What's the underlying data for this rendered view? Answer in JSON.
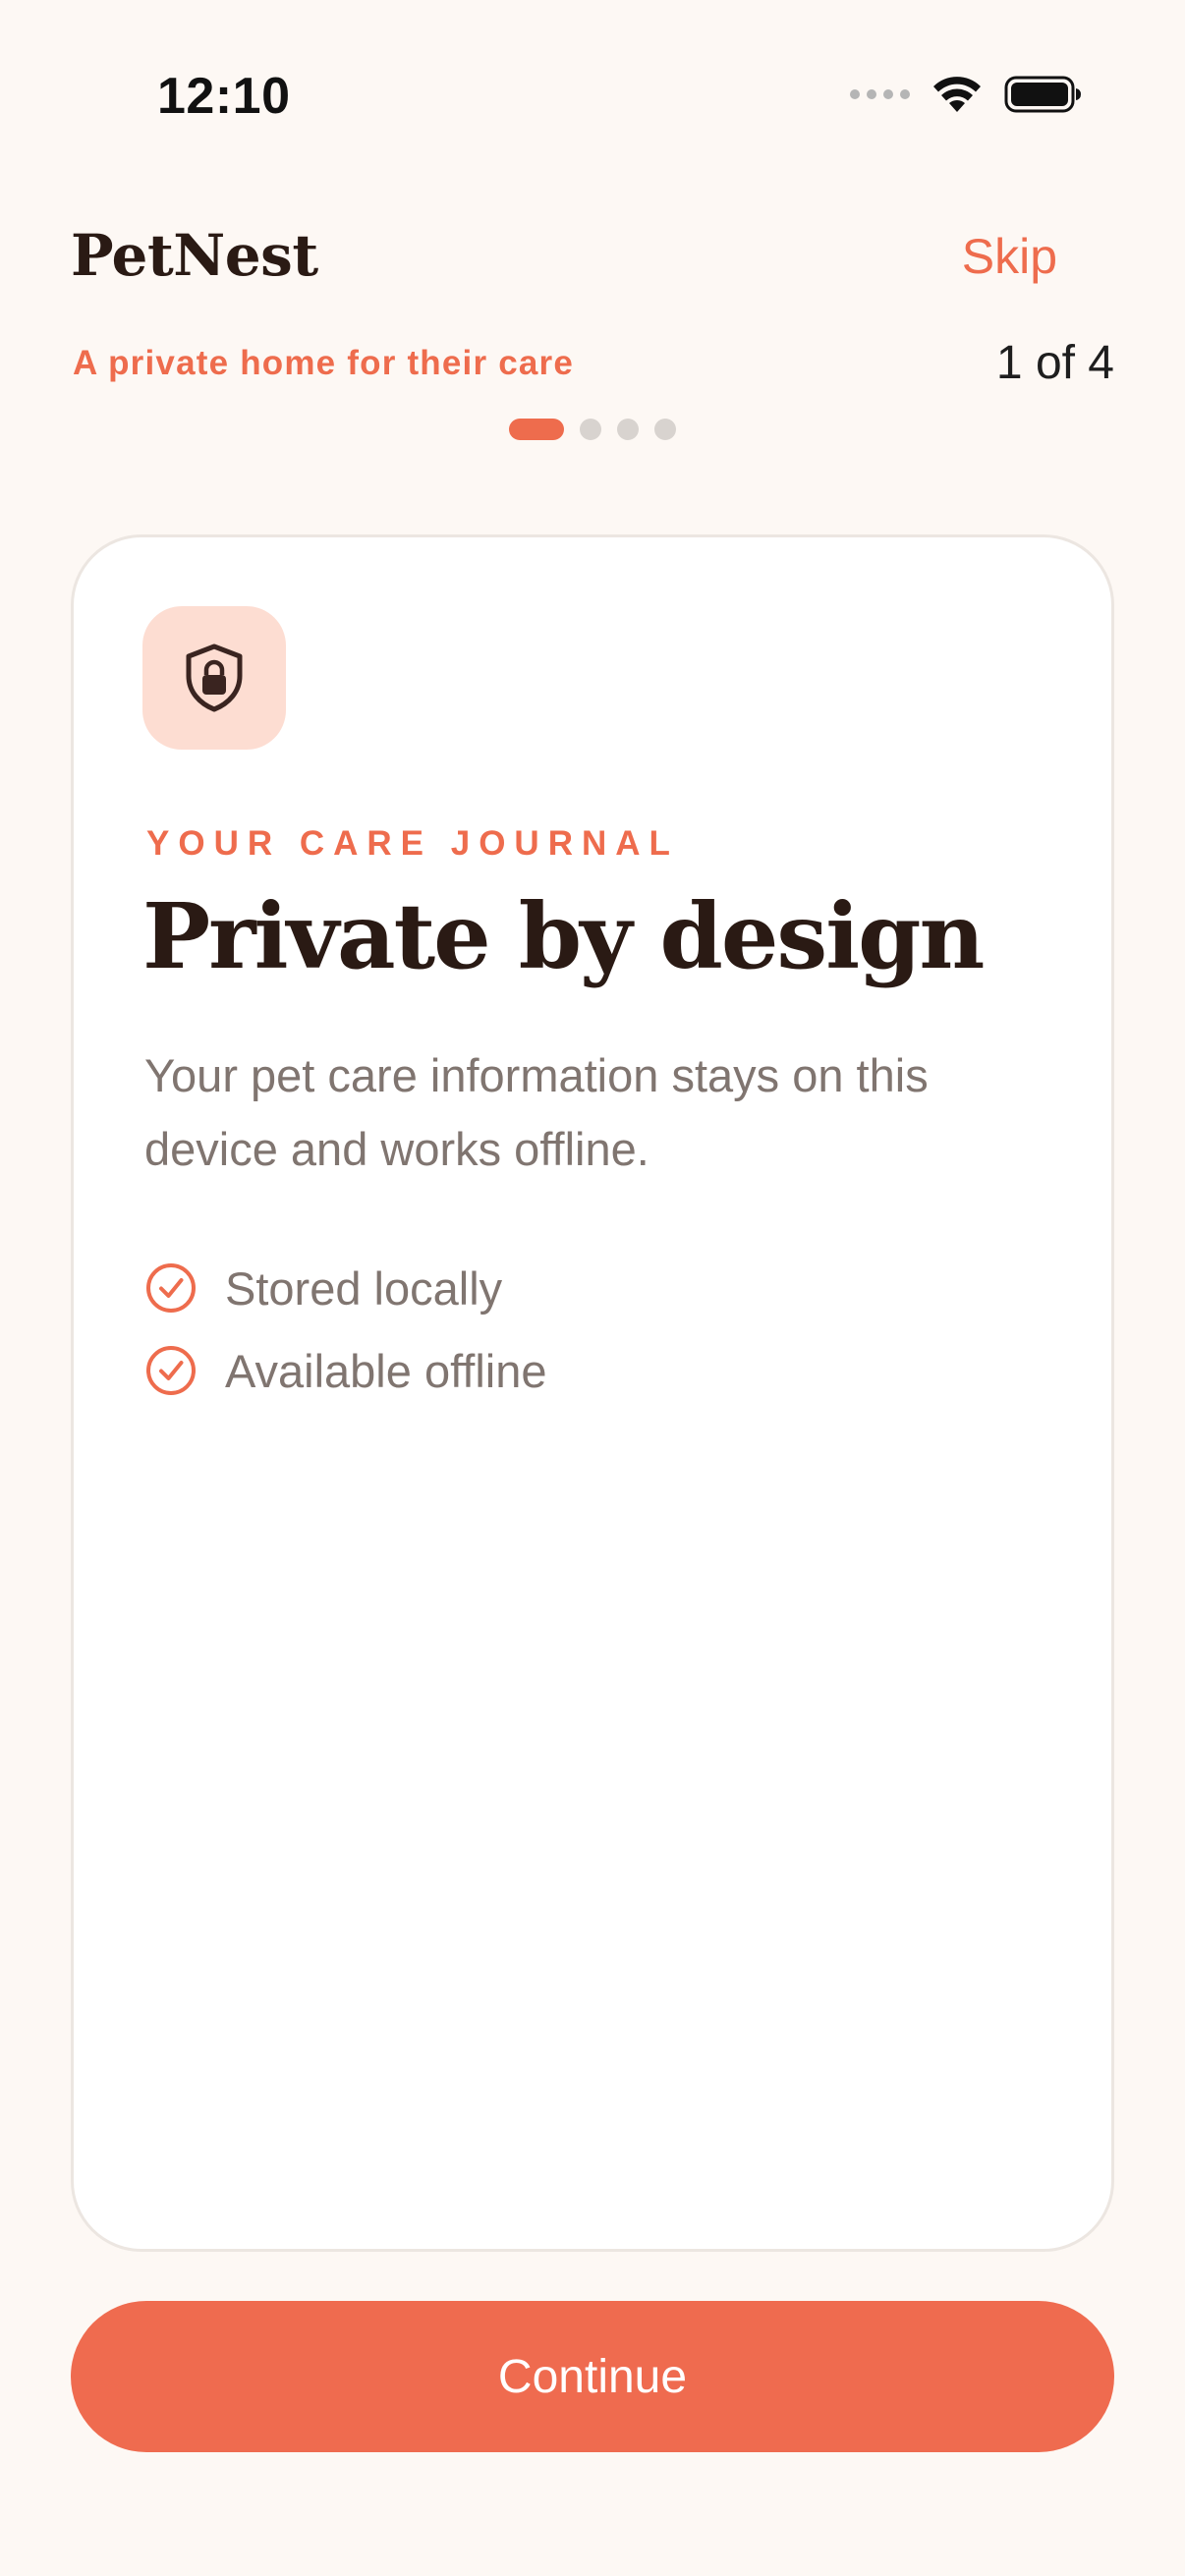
{
  "status_bar": {
    "time": "12:10",
    "icons": [
      "cellular-signal-icon",
      "wifi-icon",
      "battery-icon"
    ]
  },
  "header": {
    "brand": "PetNest",
    "skip_label": "Skip",
    "tagline": "A private home for their care",
    "step_count": "1 of 4"
  },
  "pagination": {
    "total": 4,
    "active_index": 0
  },
  "card": {
    "icon": "shield-lock-icon",
    "eyebrow": "YOUR CARE JOURNAL",
    "headline": "Private by design",
    "body": "Your pet care information stays on this device and works offline.",
    "features": [
      {
        "label": "Stored locally",
        "icon": "check-circle-icon"
      },
      {
        "label": "Available offline",
        "icon": "check-circle-icon"
      }
    ]
  },
  "cta": {
    "label": "Continue"
  },
  "colors": {
    "background": "#FDF8F4",
    "accent": "#EE6C4D",
    "icon_tile": "#FDDDD2",
    "heading": "#2A1A14",
    "body_text": "#807570"
  }
}
